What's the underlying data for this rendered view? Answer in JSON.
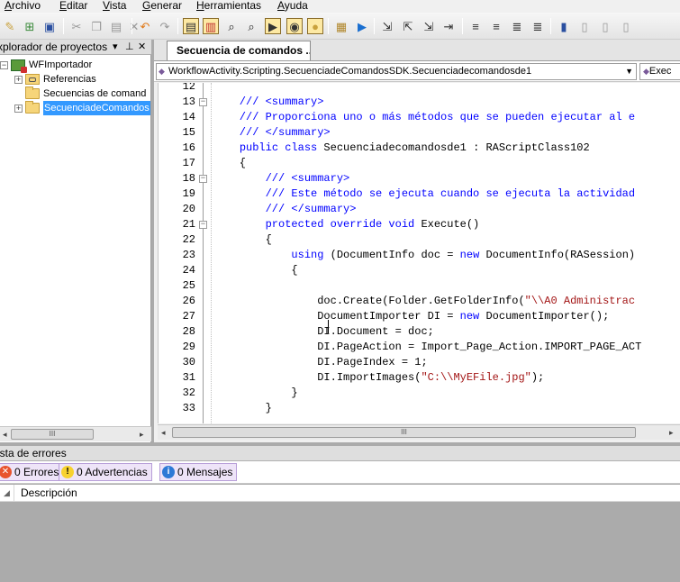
{
  "menu": [
    {
      "label": "Archivo",
      "mnemonic": "A"
    },
    {
      "label": "Editar",
      "mnemonic": "E"
    },
    {
      "label": "Vista",
      "mnemonic": "V"
    },
    {
      "label": "Generar",
      "mnemonic": "G"
    },
    {
      "label": "Herramientas",
      "mnemonic": "H"
    },
    {
      "label": "Ayuda",
      "mnemonic": "A"
    }
  ],
  "toolbar_icons": [
    "new-project-icon",
    "add-item-icon",
    "save-icon",
    "cut-icon",
    "copy-icon",
    "paste-icon",
    "delete-icon",
    "undo-icon",
    "redo-icon",
    "toggle-view-icon",
    "toggle-breakpoint-icon",
    "find-icon",
    "find-next-icon",
    "find-in-files-icon",
    "find-symbol-icon",
    "replace-icon",
    "build-icon",
    "run-icon",
    "step-into-icon",
    "step-over-icon",
    "step-out-icon",
    "indent-icon",
    "outdent-icon",
    "comment-icon",
    "uncomment-icon",
    "bookmark-icon",
    "next-bookmark-icon",
    "clear-bookmarks-icon"
  ],
  "explorer": {
    "title": "xplorador de proyectos",
    "tree": [
      {
        "label": "WFImportador",
        "level": 0,
        "toggle": "−",
        "icon": "project-icon"
      },
      {
        "label": "Referencias",
        "level": 1,
        "toggle": "+",
        "icon": "references-icon"
      },
      {
        "label": "Secuencias de comand",
        "level": 1,
        "toggle": "",
        "icon": "folder-icon"
      },
      {
        "label": "SecuenciadeComandos",
        "level": 1,
        "toggle": "+",
        "icon": "folder-icon",
        "selected": true
      }
    ]
  },
  "editor": {
    "tab_label": "Secuencia de comandos ...",
    "nav_class": "WorkflowActivity.Scripting.SecuenciadeComandosSDK.Secuenciadecomandosde1",
    "nav_member": "Exec",
    "lines": [
      {
        "n": "12",
        "fold": "",
        "tokens": []
      },
      {
        "n": "13",
        "fold": "−",
        "tokens": [
          {
            "t": "    /// <summary>",
            "c": "comment"
          }
        ]
      },
      {
        "n": "14",
        "fold": "",
        "tokens": [
          {
            "t": "    /// Proporciona uno o más métodos que se pueden ejecutar al e",
            "c": "comment"
          }
        ]
      },
      {
        "n": "15",
        "fold": "",
        "tokens": [
          {
            "t": "    /// </summary>",
            "c": "comment"
          }
        ]
      },
      {
        "n": "16",
        "fold": "",
        "tokens": [
          {
            "t": "    ",
            "c": ""
          },
          {
            "t": "public class",
            "c": "k"
          },
          {
            "t": " Secuenciadecomandosde1 : RAScriptClass102",
            "c": ""
          }
        ]
      },
      {
        "n": "17",
        "fold": "",
        "tokens": [
          {
            "t": "    {",
            "c": ""
          }
        ]
      },
      {
        "n": "18",
        "fold": "−",
        "tokens": [
          {
            "t": "        /// <summary>",
            "c": "comment"
          }
        ]
      },
      {
        "n": "19",
        "fold": "",
        "tokens": [
          {
            "t": "        /// Este método se ejecuta cuando se ejecuta la actividad",
            "c": "comment"
          }
        ]
      },
      {
        "n": "20",
        "fold": "",
        "tokens": [
          {
            "t": "        /// </summary>",
            "c": "comment"
          }
        ]
      },
      {
        "n": "21",
        "fold": "−",
        "tokens": [
          {
            "t": "        ",
            "c": ""
          },
          {
            "t": "protected override void",
            "c": "k"
          },
          {
            "t": " Execute()",
            "c": ""
          }
        ]
      },
      {
        "n": "22",
        "fold": "",
        "tokens": [
          {
            "t": "        {",
            "c": ""
          }
        ]
      },
      {
        "n": "23",
        "fold": "",
        "tokens": [
          {
            "t": "            ",
            "c": ""
          },
          {
            "t": "using",
            "c": "k"
          },
          {
            "t": " (DocumentInfo doc = ",
            "c": ""
          },
          {
            "t": "new",
            "c": "k"
          },
          {
            "t": " DocumentInfo(RASession)",
            "c": ""
          }
        ]
      },
      {
        "n": "24",
        "fold": "",
        "tokens": [
          {
            "t": "            {",
            "c": ""
          }
        ]
      },
      {
        "n": "25",
        "fold": "",
        "tokens": []
      },
      {
        "n": "26",
        "fold": "",
        "tokens": [
          {
            "t": "                doc.Create(Folder.GetFolderInfo(",
            "c": ""
          },
          {
            "t": "\"\\\\A0 Administrac",
            "c": "s"
          }
        ]
      },
      {
        "n": "27",
        "fold": "",
        "tokens": [
          {
            "t": "                DocumentImporter DI = ",
            "c": ""
          },
          {
            "t": "new",
            "c": "k"
          },
          {
            "t": " DocumentImporter();",
            "c": ""
          }
        ]
      },
      {
        "n": "28",
        "fold": "",
        "tokens": [
          {
            "t": "                DI.Document = doc;",
            "c": ""
          }
        ]
      },
      {
        "n": "29",
        "fold": "",
        "tokens": [
          {
            "t": "                DI.PageAction = Import_Page_Action.IMPORT_PAGE_ACT",
            "c": ""
          }
        ]
      },
      {
        "n": "30",
        "fold": "",
        "tokens": [
          {
            "t": "                DI.PageIndex = 1;",
            "c": ""
          }
        ]
      },
      {
        "n": "31",
        "fold": "",
        "tokens": [
          {
            "t": "                DI.ImportImages(",
            "c": ""
          },
          {
            "t": "\"C:\\\\MyEFile.jpg\"",
            "c": "s"
          },
          {
            "t": ");",
            "c": ""
          }
        ]
      },
      {
        "n": "32",
        "fold": "",
        "tokens": [
          {
            "t": "            }",
            "c": ""
          }
        ]
      },
      {
        "n": "33",
        "fold": "",
        "tokens": [
          {
            "t": "        }",
            "c": ""
          }
        ]
      }
    ]
  },
  "errorlist": {
    "title": "ista de errores",
    "errors": "0 Errores",
    "warnings": "0 Advertencias",
    "messages": "0 Mensajes",
    "column_description": "Descripción"
  }
}
